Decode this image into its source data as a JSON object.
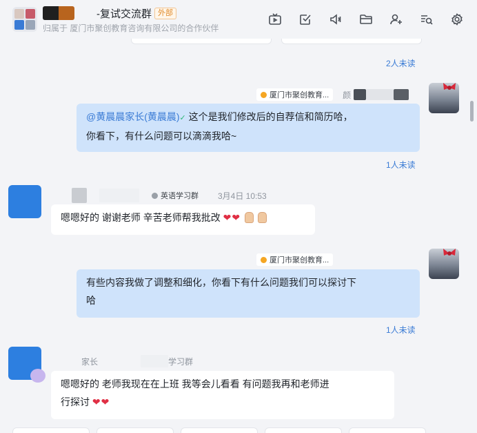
{
  "header": {
    "title": "-复试交流群",
    "badge": "外部",
    "subtitle": "归属于 厦门市聚创教育咨询有限公司的合作伙伴"
  },
  "toolbar": {
    "icons": [
      "tv-icon",
      "task-check-icon",
      "announcement-icon",
      "folder-icon",
      "add-member-icon",
      "search-history-icon",
      "settings-icon"
    ]
  },
  "messages": {
    "m0": {
      "unread": "2人未读"
    },
    "m1": {
      "org_tag": "厦门市聚创教育...",
      "sender_prefix": "颜",
      "mention": "@黄晨晨家长(黄晨晨)",
      "text_line1": " 这个是我们修改后的自荐信和简历哈，",
      "text_line2": "你看下，有什么问题可以滴滴我哈~",
      "unread": "1人未读"
    },
    "m2": {
      "group_tag": "英语学习群",
      "time": "3月4日 10:53",
      "text": "嗯嗯好的 谢谢老师 辛苦老师帮我批改",
      "hearts": "❤❤"
    },
    "m3": {
      "org_tag": "厦门市聚创教育...",
      "text_line1": "有些内容我做了调整和细化，你看下有什么问题我们可以探讨下",
      "text_line2": "哈",
      "unread": "1人未读"
    },
    "m4": {
      "sender": "家长",
      "group_tag": "学习群",
      "text_line1": "嗯嗯好的 老师我现在在上班 我等会儿看看 有问题我再和老师进",
      "text_line2": "行探讨",
      "hearts": "❤❤"
    }
  },
  "colors": {
    "accent": "#3a7bd5",
    "out_bubble": "#cfe3fb",
    "external_badge": "#e08a2a"
  }
}
